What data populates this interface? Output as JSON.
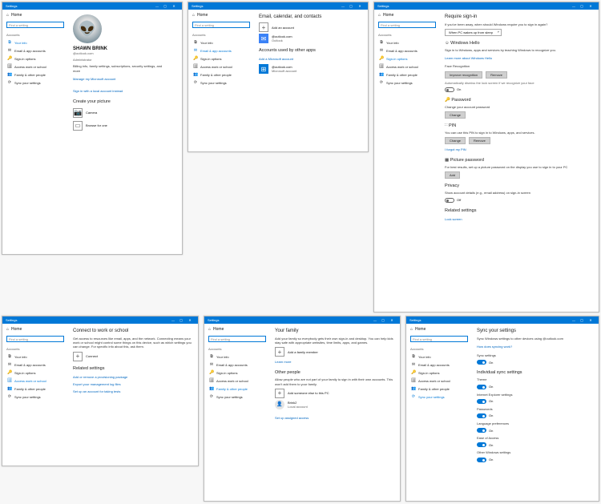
{
  "app_title": "Settings",
  "titlebar": {
    "min": "—",
    "max": "▢",
    "close": "✕"
  },
  "home": "Home",
  "search_placeholder": "Find a setting",
  "nav_section": "Accounts",
  "nav": {
    "your_info": "Your info",
    "email": "Email & app accounts",
    "sign_in": "Sign-in options",
    "work": "Access work or school",
    "family": "Family & other people",
    "sync": "Sync your settings"
  },
  "icons": {
    "home": "⌂",
    "your_info": "⧉",
    "email": "✉",
    "sign_in": "🔑",
    "work": "🗄",
    "family": "👥",
    "sync": "⟳",
    "plus": "+",
    "camera": "📷",
    "browse": "▭",
    "smile": "☺",
    "key": "🔑",
    "pin": "∷",
    "picture": "▦",
    "person": "👤",
    "alien": "👽"
  },
  "p1": {
    "page_title": "",
    "user_name": "SHAWN BRINK",
    "email": "@outlook.com",
    "role": "Administrator",
    "desc": "Billing info, family settings, subscriptions, security settings, and more",
    "manage": "Manage my Microsoft account",
    "sign_local": "Sign in with a local account instead",
    "create_pic": "Create your picture",
    "camera": "Camera",
    "browse": "Browse for one"
  },
  "p2": {
    "page_title": "Email, calendar, and contacts",
    "add_account": "Add an account",
    "acct1_email": "@outlook.com",
    "acct1_type": "Outlook",
    "section2": "Accounts used by other apps",
    "add_ms": "Add a Microsoft account",
    "acct2_email": "@outlook.com",
    "acct2_type": "Microsoft account"
  },
  "p3": {
    "page_title": "Require sign-in",
    "desc": "If you've been away, when should Windows require you to sign in again?",
    "dropdown": "When PC wakes up from sleep",
    "hello": "Windows Hello",
    "hello_desc": "Sign in to Windows, apps and services by teaching Windows to recognize you.",
    "learn_hello": "Learn more about Windows Hello",
    "face": "Face Recognition",
    "improve": "Improve recognition",
    "remove": "Remove",
    "auto_dismiss": "Automatically dismiss the lock screen if we recognize your face",
    "on": "On",
    "off": "Off",
    "password": "Password",
    "pw_desc": "Change your account password",
    "change": "Change",
    "pin": "PIN",
    "pin_desc": "You can use this PIN to sign in to Windows, apps, and services.",
    "forgot_pin": "I forgot my PIN",
    "picpw": "Picture password",
    "picpw_desc": "For best results, set up a picture password on the display you use to sign in to your PC",
    "add": "Add",
    "privacy": "Privacy",
    "privacy_desc": "Show account details (e.g., email address) on sign-in screen",
    "related": "Related settings",
    "lock_screen": "Lock screen"
  },
  "p4": {
    "page_title": "Connect to work or school",
    "desc": "Get access to resources like email, apps, and the network. Connecting means your work or school might control some things on this device, such as which settings you can change. For specific info about this, ask them.",
    "connect": "Connect",
    "related": "Related settings",
    "link1": "Add or remove a provisioning package",
    "link2": "Export your management log files",
    "link3": "Set up an account for taking tests"
  },
  "p5": {
    "page_title": "Your family",
    "desc": "Add your family so everybody gets their own sign-in and desktop. You can help kids stay safe with appropriate websites, time limits, apps, and games.",
    "add_family": "Add a family member",
    "learn": "Learn more",
    "other": "Other people",
    "other_desc": "Allow people who are not part of your family to sign in with their own accounts. This won't add them to your family.",
    "add_other": "Add someone else to this PC",
    "user2": "Brink2",
    "user2_type": "Local account",
    "assigned": "Set up assigned access"
  },
  "p6": {
    "page_title": "Sync your settings",
    "desc": "Sync Windows settings to other devices using",
    "email": "@outlook.com",
    "how": "How does syncing work?",
    "sync_settings": "Sync settings",
    "on": "On",
    "individual": "Individual sync settings",
    "items": [
      "Theme",
      "Internet Explorer settings",
      "Passwords",
      "Language preferences",
      "Ease of Access",
      "Other Windows settings"
    ]
  }
}
